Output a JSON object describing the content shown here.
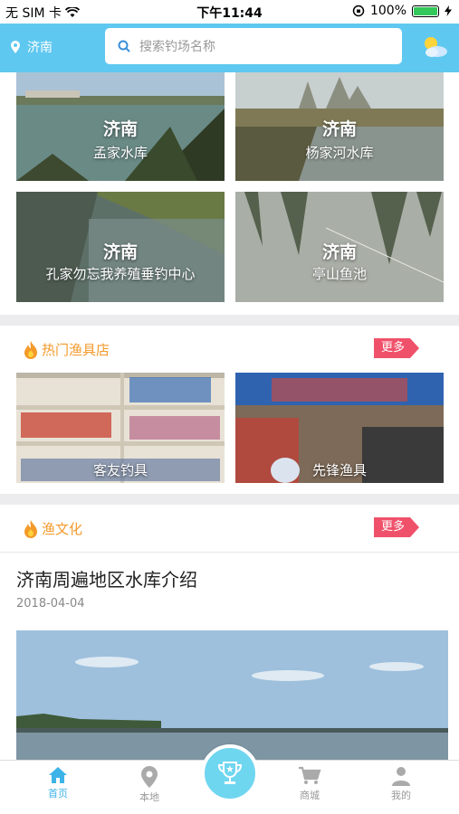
{
  "status_bar": {
    "carrier": "无 SIM 卡",
    "time": "下午11:44",
    "battery": "100%"
  },
  "header": {
    "location": "济南",
    "search_placeholder": "搜索钓场名称",
    "icons": {
      "location": "location-pin-icon",
      "search": "search-icon",
      "weather": "weather-cloud-sun-icon"
    }
  },
  "spots": [
    {
      "city": "济南",
      "name": "孟家水库"
    },
    {
      "city": "济南",
      "name": "杨家河水库"
    },
    {
      "city": "济南",
      "name": "孔家勿忘我养殖垂钓中心"
    },
    {
      "city": "济南",
      "name": "亭山鱼池"
    }
  ],
  "shops_section": {
    "title": "热门渔具店",
    "more": "更多",
    "items": [
      {
        "name": "客友钓具"
      },
      {
        "name": "先锋渔具"
      }
    ]
  },
  "culture_section": {
    "title": "渔文化",
    "more": "更多",
    "article": {
      "title": "济南周遍地区水库介绍",
      "date": "2018-04-04"
    }
  },
  "tabbar": {
    "items": [
      {
        "label": "首页",
        "icon": "home-icon",
        "active": true
      },
      {
        "label": "本地",
        "icon": "location-icon",
        "active": false
      },
      {
        "label": "",
        "icon": "trophy-icon",
        "active": false
      },
      {
        "label": "商城",
        "icon": "cart-icon",
        "active": false
      },
      {
        "label": "我的",
        "icon": "user-icon",
        "active": false
      }
    ]
  },
  "colors": {
    "header": "#5fc8f0",
    "accent_orange": "#f39a2b",
    "tag_pink": "#f0516a",
    "tab_active": "#3db3e8"
  }
}
